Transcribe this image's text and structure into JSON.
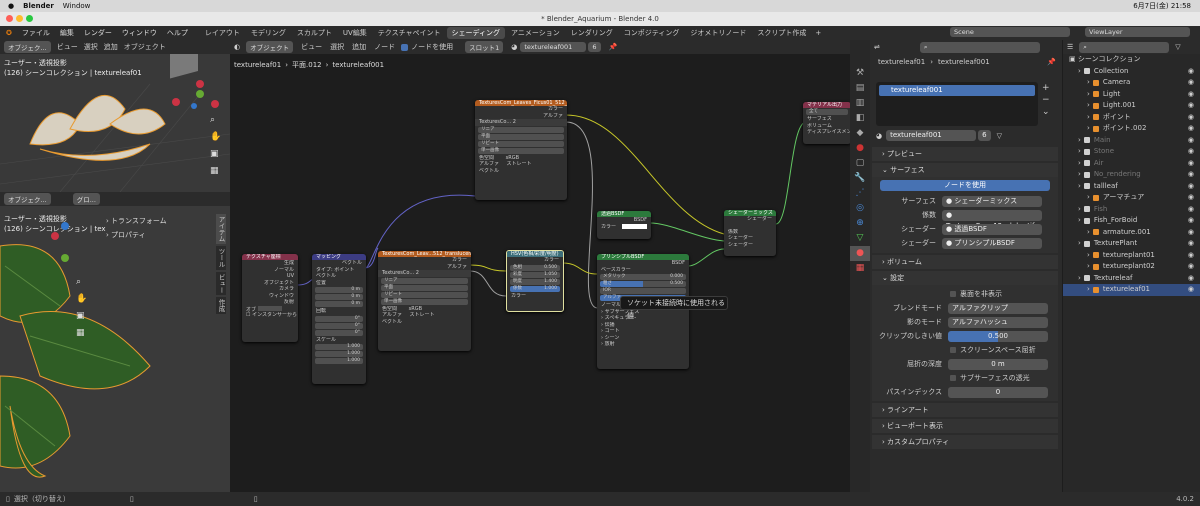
{
  "mac_menu": {
    "app": "Blender",
    "window": "Window",
    "time": "6月7日(金) 21:58"
  },
  "window_title": "* Blender_Aquarium - Blender 4.0",
  "menu": [
    "ファイル",
    "編集",
    "レンダー",
    "ウィンドウ",
    "ヘルプ"
  ],
  "workspaces": [
    "レイアウト",
    "モデリング",
    "スカルプト",
    "UV編集",
    "テクスチャペイント",
    "シェーディング",
    "アニメーション",
    "レンダリング",
    "コンポジティング",
    "ジオメトリノード",
    "スクリプト作成"
  ],
  "active_workspace": "シェーディング",
  "scene": "Scene",
  "viewlayer": "ViewLayer",
  "viewport_top": {
    "mode": "オブジェク...",
    "menus": [
      "ビュー",
      "選択",
      "追加",
      "オブジェクト"
    ],
    "info1": "ユーザー・透視投影",
    "info2": "(126) シーンコレクション | textureleaf01"
  },
  "viewport_bottom": {
    "mode": "オブジェク...",
    "orient": "グロ...",
    "info1": "ユーザー・透視投影",
    "info2": "(126) シーンコレクション | tex",
    "tabs": [
      "アイテム",
      "ツール",
      "ビュー",
      "作成"
    ],
    "items": [
      "トランスフォーム",
      "プロパティ"
    ]
  },
  "node_header": {
    "mode": "オブジェクト",
    "menus": [
      "ビュー",
      "選択",
      "追加",
      "ノード"
    ],
    "use_nodes": "ノードを使用",
    "slot": "スロット1",
    "material": "textureleaf001",
    "users": "6"
  },
  "breadcrumb": [
    "textureleaf01",
    "平面.012",
    "textureleaf001"
  ],
  "nodes": {
    "texcoord": {
      "title": "テクスチャ座標",
      "outputs": [
        "生成",
        "ノーマル",
        "UV",
        "オブジェクト",
        "カメラ",
        "ウィンドウ",
        "反射"
      ],
      "object": "オブ",
      "instancer": "インスタンサーから"
    },
    "mapping": {
      "title": "マッピング",
      "out": "ベクトル",
      "type_label": "タイプ:",
      "type": "ポイント",
      "vector": "ベクトル",
      "location": "位置",
      "x": "0 m",
      "y": "0 m",
      "z": "0 m",
      "rotation": "回転",
      "rx": "0°",
      "ry": "0°",
      "rz": "0°",
      "scale": "スケール",
      "sx": "1.000",
      "sy": "1.000",
      "sz": "1.000"
    },
    "tex1": {
      "title": "TexturesCom_Leaves_Ficus01_512_alp...",
      "img": "TexturesCo...",
      "users": "2",
      "color": "カラー",
      "alpha": "アルファ",
      "interp": "リニア",
      "proj": "平面",
      "ext": "リピート",
      "source": "単一画像",
      "cs_label": "色空間",
      "cs": "sRGB",
      "alpha_label": "アルファ",
      "alpha_mode": "ストレート",
      "vector": "ベクトル"
    },
    "tex2": {
      "title": "TexturesCom_Leav...512_translucency.tif",
      "img": "TexturesCo...",
      "users": "2",
      "color": "カラー",
      "alpha": "アルファ",
      "interp": "リニア",
      "proj": "平面",
      "ext": "リピート",
      "source": "単一画像",
      "cs_label": "色空間",
      "cs": "sRGB",
      "alpha_label": "アルファ",
      "alpha_mode": "ストレート",
      "vector": "ベクトル"
    },
    "hsv": {
      "title": "HSV(色相/彩度/明度)",
      "color": "カラー",
      "hue": "色相",
      "hue_v": "0.500",
      "sat": "彩度",
      "sat_v": "1.050",
      "val": "明度",
      "val_v": "1.400",
      "fac": "係数",
      "fac_v": "1.000",
      "color_in": "カラー"
    },
    "transparent": {
      "title": "透過BSDF",
      "bsdf": "BSDF",
      "color": "カラー"
    },
    "principled": {
      "title": "プリンシプルBSDF",
      "bsdf": "BSDF",
      "base": "ベースカラー",
      "metal": "メタリック",
      "metal_v": "0.000",
      "rough": "粗さ",
      "rough_v": "0.500",
      "ior": "IOR",
      "alpha": "アルファ",
      "normal": "ノーマル",
      "subs": "サブサーフェス",
      "spec": "スペキュラー",
      "trans": "伝播",
      "coat": "コート",
      "sheen": "シーン",
      "emit": "放射"
    },
    "mix": {
      "title": "シェーダーミックス",
      "shader": "シェーダー",
      "fac": "係数",
      "s1": "シェーダー",
      "s2": "シェーダー"
    },
    "output": {
      "title": "マテリアル出力",
      "target": "全て",
      "surface": "サーフェス",
      "volume": "ボリューム",
      "disp": "ディスプレイスメント"
    }
  },
  "tooltip": "ソケット未接続時に使用される値.",
  "properties": {
    "obj": "textureleaf01",
    "mat": "textureleaf001",
    "slot": "textureleaf001",
    "mat_field": "textureleaf001",
    "users": "6",
    "sections": {
      "preview": "プレビュー",
      "surface": "サーフェス",
      "volume": "ボリューム",
      "settings": "設定",
      "lineart": "ラインアート",
      "viewport": "ビューポート表示",
      "custom": "カスタムプロパティ"
    },
    "use_nodes": "ノードを使用",
    "surface_label": "サーフェス",
    "surface_val": "シェーダーミックス",
    "fac_label": "係数",
    "fac_val": "TexturesCo....12_alpha.tif",
    "sh1_label": "シェーダー",
    "sh1_val": "透過BSDF",
    "sh2_label": "シェーダー",
    "sh2_val": "プリンシプルBSDF",
    "backface": "裏面を非表示",
    "blend_label": "ブレンドモード",
    "blend_val": "アルファクリップ",
    "shadow_label": "影のモード",
    "shadow_val": "アルファハッシュ",
    "clip_label": "クリップのしきい値",
    "clip_val": "0.500",
    "ssr": "スクリーンスペース屈折",
    "refr_label": "屈折の深度",
    "refr_val": "0 m",
    "subs_trans": "サブサーフェスの透光",
    "pass_label": "パスインデックス",
    "pass_val": "0"
  },
  "outliner": {
    "title": "シーンコレクション",
    "items": [
      {
        "name": "Collection",
        "indent": 1,
        "dim": false
      },
      {
        "name": "Camera",
        "indent": 2,
        "dim": false
      },
      {
        "name": "Light",
        "indent": 2,
        "dim": false
      },
      {
        "name": "Light.001",
        "indent": 2,
        "dim": false
      },
      {
        "name": "ポイント",
        "indent": 2,
        "dim": false
      },
      {
        "name": "ポイント.002",
        "indent": 2,
        "dim": false
      },
      {
        "name": "Main",
        "indent": 1,
        "dim": true
      },
      {
        "name": "Stone",
        "indent": 1,
        "dim": true
      },
      {
        "name": "Air",
        "indent": 1,
        "dim": true
      },
      {
        "name": "No_rendering",
        "indent": 1,
        "dim": true
      },
      {
        "name": "tallleaf",
        "indent": 1,
        "dim": false
      },
      {
        "name": "アーマチュア",
        "indent": 2,
        "dim": false
      },
      {
        "name": "Fish",
        "indent": 1,
        "dim": true
      },
      {
        "name": "Fish_ForBoid",
        "indent": 1,
        "dim": false
      },
      {
        "name": "armature.001",
        "indent": 2,
        "dim": false
      },
      {
        "name": "TexturePlant",
        "indent": 1,
        "dim": false
      },
      {
        "name": "textureplant01",
        "indent": 2,
        "dim": false
      },
      {
        "name": "textureplant02",
        "indent": 2,
        "dim": false
      },
      {
        "name": "Textureleaf",
        "indent": 1,
        "dim": false
      },
      {
        "name": "textureleaf01",
        "indent": 2,
        "dim": false
      }
    ]
  },
  "status": {
    "left": "選択（切り替え）",
    "version": "4.0.2"
  }
}
